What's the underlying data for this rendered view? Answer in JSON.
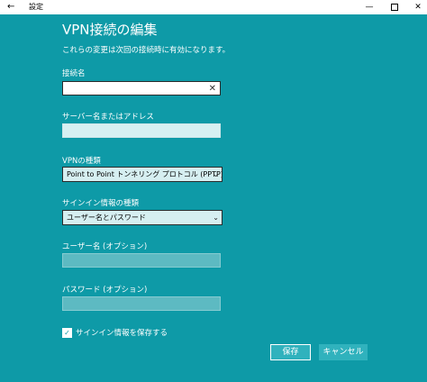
{
  "window": {
    "back_glyph": "←",
    "title": "設定",
    "min_glyph": "—",
    "close_glyph": "✕"
  },
  "dialog": {
    "heading": "VPN接続の編集",
    "description": "これらの変更は次回の接続時に有効になります。",
    "connection_name": {
      "label": "接続名",
      "value": "",
      "clear_glyph": "✕"
    },
    "server_address": {
      "label": "サーバー名またはアドレス",
      "value": ""
    },
    "vpn_type": {
      "label": "VPNの種類",
      "selected": "Point to Point トンネリング プロトコル (PPTP)"
    },
    "signin_type": {
      "label": "サインイン情報の種類",
      "selected": "ユーザー名とパスワード"
    },
    "username": {
      "label": "ユーザー名 (オプション)",
      "value": ""
    },
    "password": {
      "label": "パスワード (オプション)",
      "value": ""
    },
    "remember": {
      "label": "サインイン情報を保存する",
      "checked": true,
      "check_glyph": "✓"
    },
    "chevron_glyph": "⌄",
    "save_label": "保存",
    "cancel_label": "キャンセル"
  },
  "colors": {
    "background": "#0e9aa7",
    "button": "#30b2bd",
    "field_light": "#d6f0f2"
  }
}
